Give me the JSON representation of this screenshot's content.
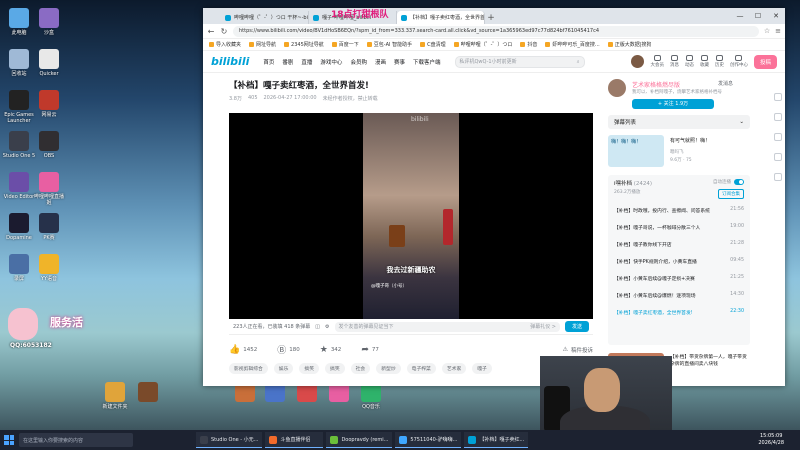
{
  "stream_overlay": {
    "title": "18点打甜根队",
    "badge_name": "服务活",
    "badge_qq": "QQ:6053182"
  },
  "desktop_icons": [
    {
      "label": "此电脑",
      "color": "#5aa9e6"
    },
    {
      "label": "沙盒",
      "color": "#8a6bc4"
    },
    {
      "label": "回收站",
      "color": "#9fb9d6"
    },
    {
      "label": "Quicker",
      "color": "#e8e8e8"
    },
    {
      "label": "Epic Games Launcher",
      "color": "#222222"
    },
    {
      "label": "网易云",
      "color": "#c0392b"
    },
    {
      "label": "Studio One 5",
      "color": "#3a3f4b"
    },
    {
      "label": "OBS",
      "color": "#302e31"
    },
    {
      "label": "Video Editor",
      "color": "#6b4ea8"
    },
    {
      "label": "哔哩哔哩直播姬",
      "color": "#e85fa2"
    },
    {
      "label": "Dopamine",
      "color": "#1b1b2f"
    },
    {
      "label": "PK赛",
      "color": "#26314a"
    },
    {
      "label": "录屏",
      "color": "#4a6fa5"
    },
    {
      "label": "YY语音",
      "color": "#f0b429"
    }
  ],
  "taskbar_desktop_row": [
    {
      "label": "新建文件夹",
      "color": "#e0a43a"
    },
    {
      "label": "",
      "color": "#7a4a2a"
    },
    {
      "label": "",
      "color": "#c96f3a"
    },
    {
      "label": "",
      "color": "#4a74c9"
    },
    {
      "label": "",
      "color": "#d94a4a"
    },
    {
      "label": "",
      "color": "#e85fa2"
    },
    {
      "label": "QQ音乐",
      "color": "#2fb36b"
    }
  ],
  "browser": {
    "tabs": [
      {
        "title": "哔哩哔哩（゜-゜）つロ 干杯~-bilibili",
        "active": false
      },
      {
        "title": "嘎子-哔哩哔哩_bilibili",
        "active": false
      },
      {
        "title": "【补档】嘎子卖红枣酒，全世界首发",
        "active": true
      }
    ],
    "url": "https://www.bilibili.com/video/BV1dHoSB6EQn/?spm_id_from=333.337.search-card.all.click&vd_source=1a365963ed97c77d824bf761045417c4",
    "bookmarks": [
      "导入收藏夹",
      "网址导航",
      "2345网址导航",
      "百度一下",
      "豆包-AI 智能助手",
      "C盘清理",
      "哔哩哔哩（゜-゜）つロ",
      "抖音",
      "虾哔哔可乐_百度搜...",
      "正版大数据|搜狗"
    ],
    "bili": {
      "logo": "bilibili",
      "nav": [
        "首页",
        "番剧",
        "直播",
        "游戏中心",
        "会员购",
        "漫画",
        "赛事",
        "下载客户端"
      ],
      "search_placeholder": "私评机QwQ-1小时前更新",
      "header_icons": [
        "大会员",
        "消息",
        "动态",
        "收藏",
        "历史",
        "创作中心"
      ],
      "upload_label": "投稿",
      "video": {
        "title": "【补档】嘎子卖红枣酒，全世界首发!",
        "views": "3.8万",
        "danmaku": "405",
        "date": "2026-04-27 17:00:00",
        "notice": "未经作者授权，禁止转载",
        "watermark": "bilibili",
        "subtitle": "我去过新疆助农",
        "handle": "@嘎子哥（小号）",
        "viewers": "223人正在看，已装填 418 条弹幕",
        "danmaku_placeholder": "发个友善的弹幕见证当下",
        "etiquette": "弹幕礼仪 >",
        "send": "发送",
        "likes": "1452",
        "coins": "180",
        "favs": "342",
        "shares": "77",
        "notes": "稿件投诉",
        "tags": [
          "影视剪辑综合",
          "娱乐",
          "搞笑",
          "搞笑",
          "社会",
          "新型炒",
          "电子榨菜",
          "艺术家",
          "嘎子"
        ]
      },
      "uploader": {
        "name": "艺术家格格燃尽版",
        "desc": "我可以、补档阿嘎子，烧攀艺术家格格补档号",
        "follow": "+ 关注 1.9万",
        "msg": "发消息"
      },
      "danmaku_list_label": "弹幕列表",
      "recommended": {
        "thumb_text": "嗨！嗨！嗨！",
        "title": "有可气就照！嗨！",
        "up": "嗯吗飞",
        "stats": "9.6万 · 75"
      },
      "playlist": {
        "title": "i嘿补档",
        "count": "(2424)",
        "sub": "263.2万播放",
        "autoplay": "自动连播",
        "subscribe": "订阅合集",
        "episodes": [
          {
            "title": "【补档】时政哦，投内行、查擦闻、问答系统",
            "duration": "21:56",
            "active": false
          },
          {
            "title": "【补档】嘎子哥说，一杯咖啡分散三个人",
            "duration": "19:00",
            "active": false
          },
          {
            "title": "【补档】嘎子教你线下开店",
            "duration": "21:28",
            "active": false
          },
          {
            "title": "【补档】快手PK规则介绍，小黄车直播",
            "duration": "09:45",
            "active": false
          },
          {
            "title": "【补档】小黄车后续@嘎子定损+决赛",
            "duration": "21:25",
            "active": false
          },
          {
            "title": "【补档】小黄车后续@爆燃！逐项现场",
            "duration": "14:30",
            "active": false
          },
          {
            "title": "【补档】嘎子卖红枣酒，全世界首发!",
            "duration": "22:30",
            "active": true
          }
        ]
      },
      "below_rec": {
        "title": "【补档】带货杂牌第一人，嘎子带货杂牌的直播间卖八块钱"
      }
    }
  },
  "taskbar": {
    "search": "在这里输入你要搜索的内容",
    "items": [
      {
        "label": "Studio One - 小无...",
        "color": "#3a3f4b"
      },
      {
        "label": "斗鱼直播伴侣",
        "color": "#f36b2b"
      },
      {
        "label": "Doopravdy (remi...",
        "color": "#6bbf3a"
      },
      {
        "label": "57511040-驴嗨嗨...",
        "color": "#3fa7ff"
      },
      {
        "label": "【补档】嘎子卖红...",
        "color": "#00a1d6"
      }
    ],
    "time": "15:05:09",
    "date": "2026/4/28"
  }
}
